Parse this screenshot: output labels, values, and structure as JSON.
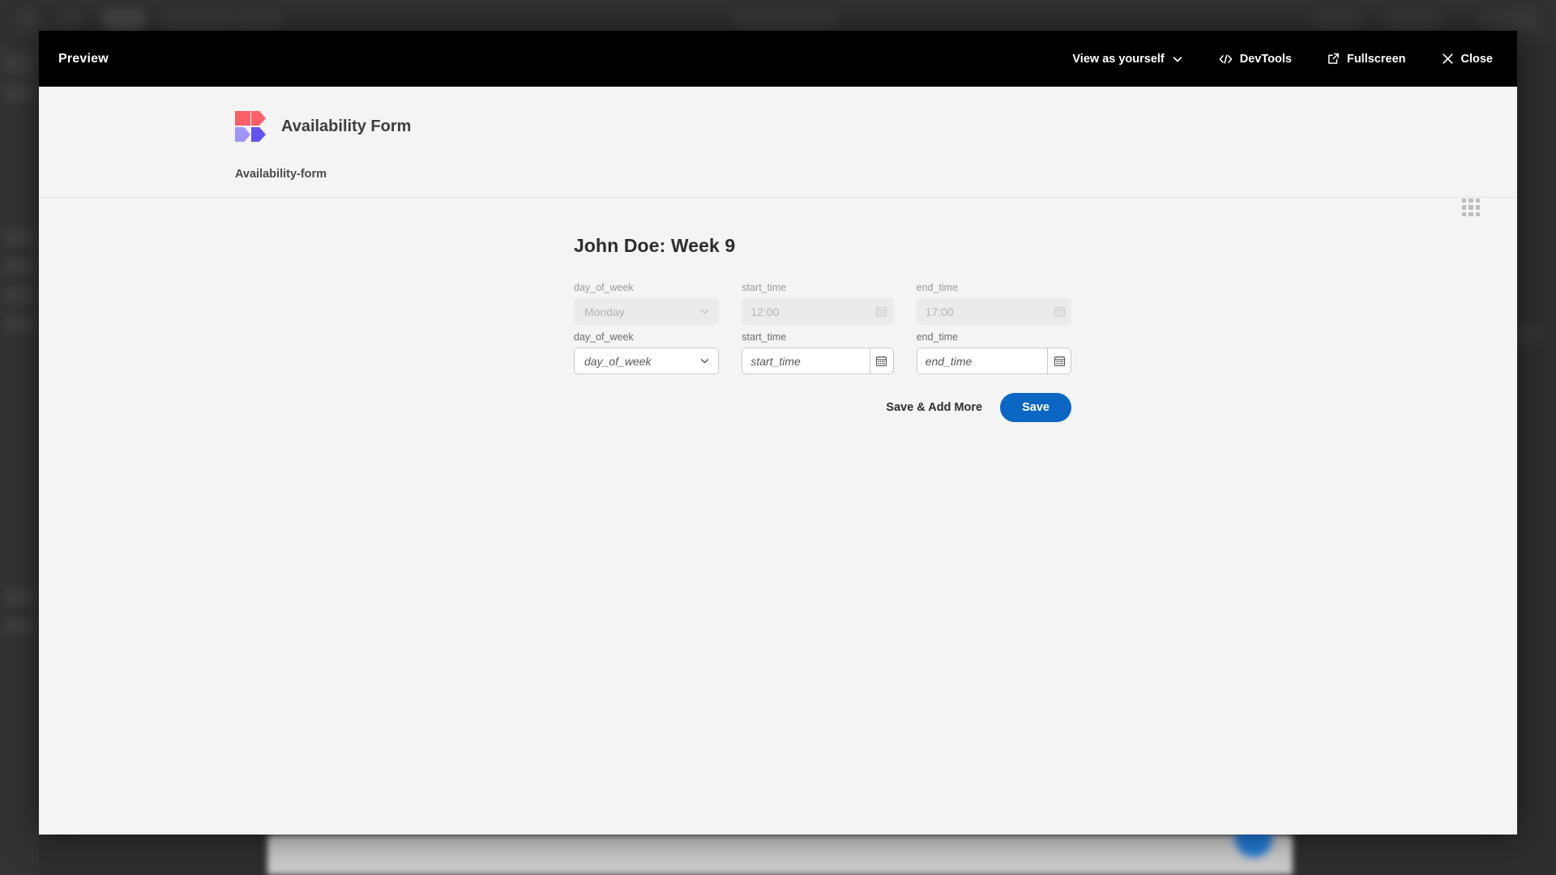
{
  "backdrop": {
    "note": "dimmed blurred host application behind modal"
  },
  "preview_toolbar": {
    "title": "Preview",
    "actions": [
      {
        "label": "View as yourself",
        "icon": "chevron-down-icon"
      },
      {
        "label": "DevTools",
        "icon": "code-brackets-icon"
      },
      {
        "label": "Fullscreen",
        "icon": "external-link-icon"
      },
      {
        "label": "Close",
        "icon": "close-icon"
      }
    ]
  },
  "app_header": {
    "logo": "availability-form-logo",
    "title": "Availability Form",
    "breadcrumb": "Availability-form",
    "grid_menu": "apps-grid-icon"
  },
  "form": {
    "title": "John Doe: Week 9",
    "rows": [
      {
        "disabled": true,
        "day_of_week": {
          "label": "day_of_week",
          "value": "Monday"
        },
        "start_time": {
          "label": "start_time",
          "value": "12:00",
          "icon": "calendar-icon"
        },
        "end_time": {
          "label": "end_time",
          "value": "17:00",
          "icon": "calendar-icon"
        }
      },
      {
        "disabled": false,
        "day_of_week": {
          "label": "day_of_week",
          "value": "day_of_week"
        },
        "start_time": {
          "label": "start_time",
          "value": "start_time",
          "icon": "calendar-icon"
        },
        "end_time": {
          "label": "end_time",
          "value": "end_time",
          "icon": "calendar-icon"
        }
      }
    ],
    "actions": {
      "save_add_more_label": "Save & Add More",
      "save_label": "Save"
    }
  },
  "colors": {
    "toolbar_bg": "#000000",
    "page_bg": "#f4f4f4",
    "primary_button": "#0a66c2",
    "logo_red": "#fb5f68",
    "logo_light_purple": "#9e96fa",
    "logo_purple": "#6152ef"
  }
}
